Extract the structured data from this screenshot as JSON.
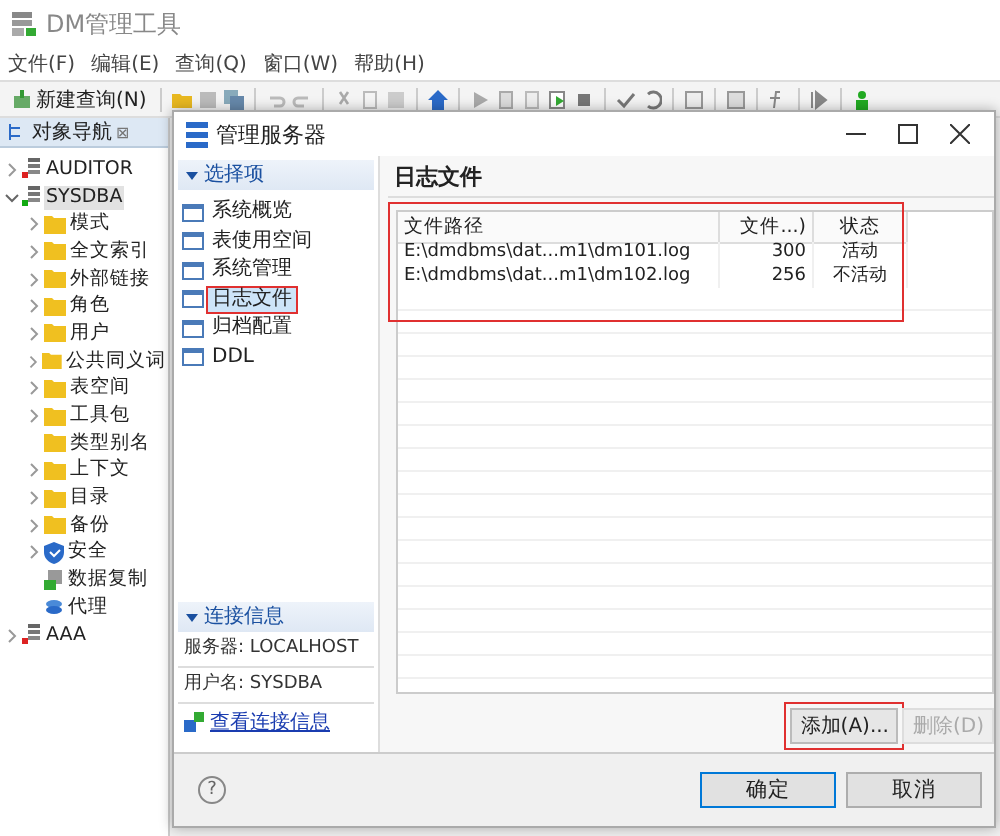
{
  "window": {
    "title": "DM管理工具"
  },
  "menu": [
    "文件(F)",
    "编辑(E)",
    "查询(Q)",
    "窗口(W)",
    "帮助(H)"
  ],
  "toolbar": {
    "new_query": "新建查询(N)"
  },
  "navigator": {
    "tab": "对象导航",
    "close": "⊠",
    "tree": [
      {
        "label": "AUDITOR",
        "kind": "database",
        "connected": false,
        "expanded": false,
        "leaf": false,
        "selected": false
      },
      {
        "label": "SYSDBA",
        "kind": "database",
        "connected": true,
        "expanded": true,
        "leaf": false,
        "selected": true,
        "children": [
          {
            "label": "模式",
            "kind": "folder",
            "expanded": false,
            "leaf": false,
            "selected": false
          },
          {
            "label": "全文索引",
            "kind": "folder",
            "expanded": false,
            "leaf": false,
            "selected": false
          },
          {
            "label": "外部链接",
            "kind": "folder",
            "expanded": false,
            "leaf": false,
            "selected": false
          },
          {
            "label": "角色",
            "kind": "folder",
            "expanded": false,
            "leaf": false,
            "selected": false
          },
          {
            "label": "用户",
            "kind": "folder",
            "expanded": false,
            "leaf": false,
            "selected": false
          },
          {
            "label": "公共同义词",
            "kind": "folder",
            "expanded": false,
            "leaf": false,
            "selected": false
          },
          {
            "label": "表空间",
            "kind": "folder",
            "expanded": false,
            "leaf": false,
            "selected": false
          },
          {
            "label": "工具包",
            "kind": "folder",
            "expanded": false,
            "leaf": false,
            "selected": false
          },
          {
            "label": "类型别名",
            "kind": "folder",
            "expanded": false,
            "leaf": true,
            "selected": false
          },
          {
            "label": "上下文",
            "kind": "folder",
            "expanded": false,
            "leaf": false,
            "selected": false
          },
          {
            "label": "目录",
            "kind": "folder",
            "expanded": false,
            "leaf": false,
            "selected": false
          },
          {
            "label": "备份",
            "kind": "folder",
            "expanded": false,
            "leaf": false,
            "selected": false
          },
          {
            "label": "安全",
            "kind": "shield",
            "expanded": false,
            "leaf": false,
            "selected": false
          },
          {
            "label": "数据复制",
            "kind": "replication",
            "expanded": false,
            "leaf": true,
            "selected": false
          },
          {
            "label": "代理",
            "kind": "agent",
            "expanded": false,
            "leaf": true,
            "selected": false
          }
        ]
      },
      {
        "label": "AAA",
        "kind": "database",
        "connected": false,
        "expanded": false,
        "leaf": false,
        "selected": false
      }
    ]
  },
  "dialog": {
    "title": "管理服务器",
    "options": {
      "header": "选择项",
      "items": [
        {
          "label": "系统概览",
          "selected": false
        },
        {
          "label": "表使用空间",
          "selected": false
        },
        {
          "label": "系统管理",
          "selected": false
        },
        {
          "label": "日志文件",
          "selected": true
        },
        {
          "label": "归档配置",
          "selected": false
        },
        {
          "label": "DDL",
          "selected": false
        }
      ]
    },
    "connection": {
      "header": "连接信息",
      "server": "服务器: LOCALHOST",
      "user": "用户名: SYSDBA",
      "link": "查看连接信息"
    },
    "page_title": "日志文件",
    "table": {
      "columns": [
        "文件路径",
        "文件...)",
        "状态"
      ],
      "rows": [
        [
          "E:\\dmdbms\\dat...m1\\dm101.log",
          "300",
          "活动"
        ],
        [
          "E:\\dmdbms\\dat...m1\\dm102.log",
          "256",
          "不活动"
        ]
      ]
    },
    "actions": [
      {
        "label": "添加(A)...",
        "disabled": false
      },
      {
        "label": "删除(D)",
        "disabled": true
      }
    ],
    "help": "?",
    "buttons": [
      {
        "label": "确定",
        "default": true
      },
      {
        "label": "取消",
        "default": false
      }
    ]
  }
}
